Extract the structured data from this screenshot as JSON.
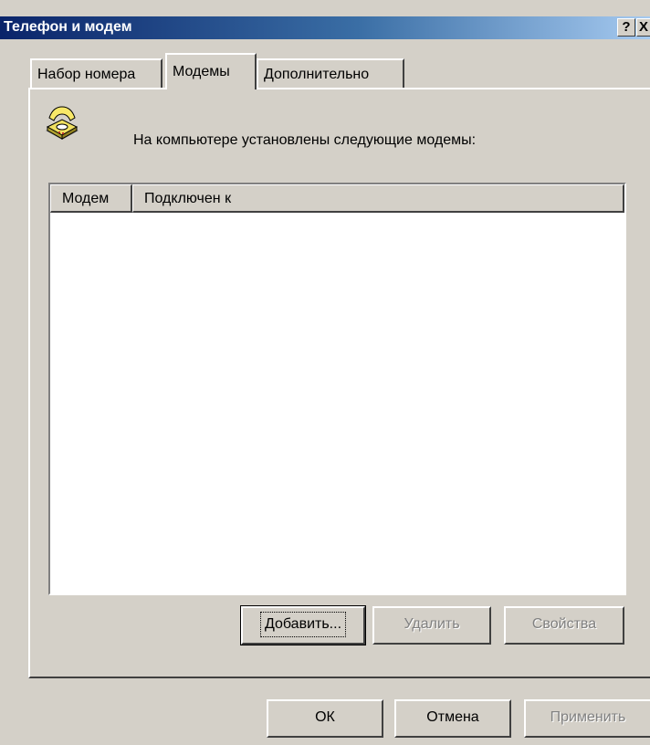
{
  "window": {
    "title": "Телефон и модем"
  },
  "titlebar": {
    "help": "?",
    "close": "X"
  },
  "tabs": [
    {
      "label": "Набор номера",
      "active": false
    },
    {
      "label": "Модемы",
      "active": true
    },
    {
      "label": "Дополнительно",
      "active": false
    }
  ],
  "modems_tab": {
    "intro": "На компьютере установлены следующие модемы:",
    "icon": "phone-icon",
    "columns": [
      "Модем",
      "Подключен к"
    ],
    "rows": []
  },
  "buttons": {
    "add": "Добавить...",
    "remove": "Удалить",
    "properties": "Свойства",
    "ok": "ОК",
    "cancel": "Отмена",
    "apply": "Применить"
  },
  "colors": {
    "titlebar_start": "#0a246a",
    "titlebar_end": "#a6caf0",
    "face": "#d4d0c8",
    "disabled_text": "#808080"
  }
}
